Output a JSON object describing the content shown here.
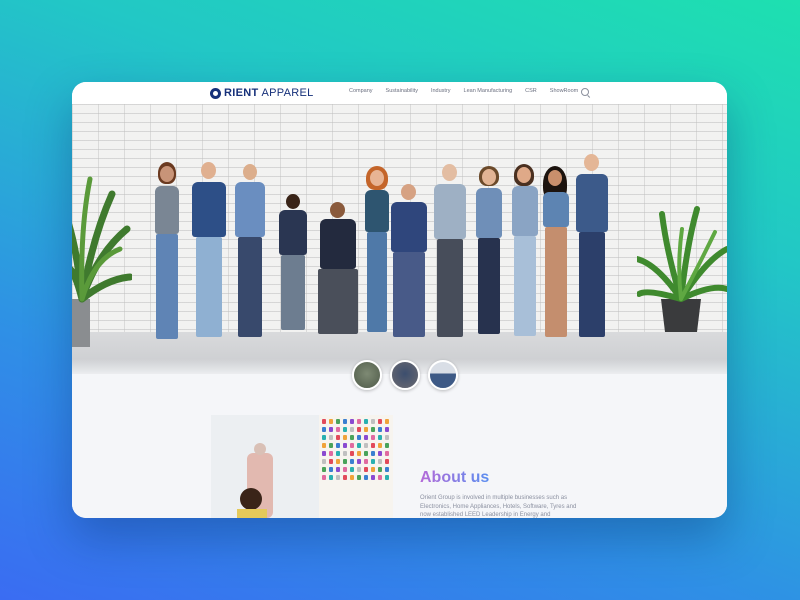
{
  "header": {
    "logo_bold": "RIENT",
    "logo_light": "APPAREL",
    "nav": [
      "Company",
      "Sustainability",
      "Industry",
      "Lean Manufacturing",
      "CSR",
      "ShowRoom"
    ]
  },
  "hero": {
    "thumbnail_count": 3
  },
  "about": {
    "title": "About us",
    "text": "Orient Group is involved in multiple businesses such as Electronics, Home Appliances, Hotels, Software, Tyres and now established LEED Leadership in Energy and"
  },
  "colors": {
    "brand": "#16307a",
    "title_gradient_start": "#b56ad8",
    "title_gradient_end": "#5b8ef0",
    "background_top": "#1ee0b0",
    "background_bottom": "#3a6cf2"
  }
}
